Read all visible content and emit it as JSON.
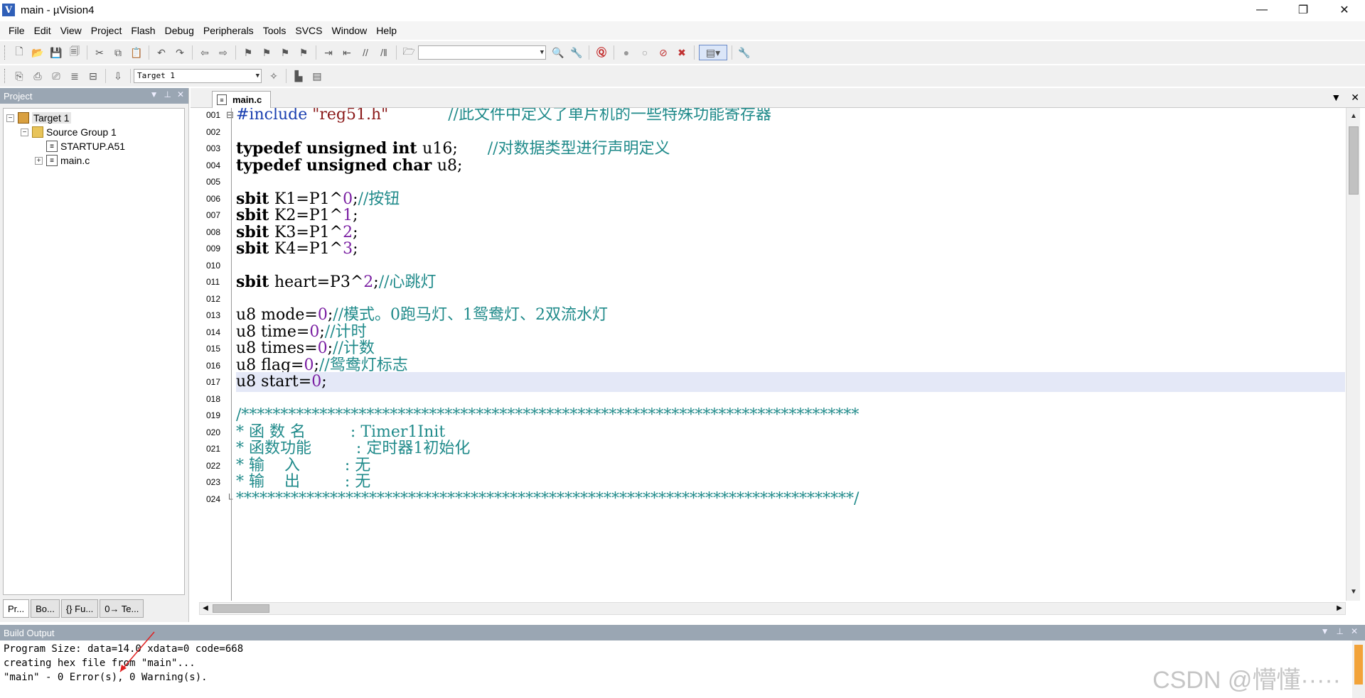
{
  "window": {
    "title": "main - µVision4",
    "controls": [
      "—",
      "❐",
      "✕"
    ]
  },
  "menu": [
    "File",
    "Edit",
    "View",
    "Project",
    "Flash",
    "Debug",
    "Peripherals",
    "Tools",
    "SVCS",
    "Window",
    "Help"
  ],
  "toolbar2": {
    "target_combo": "Target 1"
  },
  "project_pane": {
    "title": "Project",
    "tree": {
      "target": "Target 1",
      "group": "Source Group 1",
      "files": [
        "STARTUP.A51",
        "main.c"
      ]
    },
    "tabs": [
      "Pr...",
      "Bo...",
      "{} Fu...",
      "0→ Te..."
    ]
  },
  "editor": {
    "tab_label": "main.c",
    "lines": [
      {
        "n": "001",
        "fold": "⊟",
        "segments": [
          {
            "t": "#include ",
            "c": "pp"
          },
          {
            "t": "\"reg51.h\"",
            "c": "str"
          },
          {
            "t": "            //此文件中定义了单片机的一些特殊功能寄存器",
            "c": "cmt"
          }
        ]
      },
      {
        "n": "002",
        "segments": []
      },
      {
        "n": "003",
        "segments": [
          {
            "t": "typedef unsigned int ",
            "c": "kw"
          },
          {
            "t": "u16;",
            "c": "op"
          },
          {
            "t": "      //对数据类型进行声明定义",
            "c": "cmt"
          }
        ]
      },
      {
        "n": "004",
        "segments": [
          {
            "t": "typedef unsigned char ",
            "c": "kw"
          },
          {
            "t": "u8;",
            "c": "op"
          }
        ]
      },
      {
        "n": "005",
        "segments": []
      },
      {
        "n": "006",
        "segments": [
          {
            "t": "sbit ",
            "c": "kw"
          },
          {
            "t": "K1=P1^",
            "c": "op"
          },
          {
            "t": "0",
            "c": "num"
          },
          {
            "t": ";",
            "c": "op"
          },
          {
            "t": "//按钮",
            "c": "cmt"
          }
        ]
      },
      {
        "n": "007",
        "segments": [
          {
            "t": "sbit ",
            "c": "kw"
          },
          {
            "t": "K2=P1^",
            "c": "op"
          },
          {
            "t": "1",
            "c": "num"
          },
          {
            "t": ";",
            "c": "op"
          }
        ]
      },
      {
        "n": "008",
        "segments": [
          {
            "t": "sbit ",
            "c": "kw"
          },
          {
            "t": "K3=P1^",
            "c": "op"
          },
          {
            "t": "2",
            "c": "num"
          },
          {
            "t": ";",
            "c": "op"
          }
        ]
      },
      {
        "n": "009",
        "segments": [
          {
            "t": "sbit ",
            "c": "kw"
          },
          {
            "t": "K4=P1^",
            "c": "op"
          },
          {
            "t": "3",
            "c": "num"
          },
          {
            "t": ";",
            "c": "op"
          }
        ]
      },
      {
        "n": "010",
        "segments": []
      },
      {
        "n": "011",
        "segments": [
          {
            "t": "sbit ",
            "c": "kw"
          },
          {
            "t": "heart=P3^",
            "c": "op"
          },
          {
            "t": "2",
            "c": "num"
          },
          {
            "t": ";",
            "c": "op"
          },
          {
            "t": "//心跳灯",
            "c": "cmt"
          }
        ]
      },
      {
        "n": "012",
        "segments": []
      },
      {
        "n": "013",
        "segments": [
          {
            "t": "u8 mode=",
            "c": "op"
          },
          {
            "t": "0",
            "c": "num"
          },
          {
            "t": ";",
            "c": "op"
          },
          {
            "t": "//模式。0跑马灯、1鸳鸯灯、2双流水灯",
            "c": "cmt"
          }
        ]
      },
      {
        "n": "014",
        "segments": [
          {
            "t": "u8 time=",
            "c": "op"
          },
          {
            "t": "0",
            "c": "num"
          },
          {
            "t": ";",
            "c": "op"
          },
          {
            "t": "//计时",
            "c": "cmt"
          }
        ]
      },
      {
        "n": "015",
        "segments": [
          {
            "t": "u8 times=",
            "c": "op"
          },
          {
            "t": "0",
            "c": "num"
          },
          {
            "t": ";",
            "c": "op"
          },
          {
            "t": "//计数",
            "c": "cmt"
          }
        ]
      },
      {
        "n": "016",
        "segments": [
          {
            "t": "u8 flag=",
            "c": "op"
          },
          {
            "t": "0",
            "c": "num"
          },
          {
            "t": ";",
            "c": "op"
          },
          {
            "t": "//鸳鸯灯标志",
            "c": "cmt"
          }
        ]
      },
      {
        "n": "017",
        "current": true,
        "segments": [
          {
            "t": "u8 start=",
            "c": "op"
          },
          {
            "t": "0",
            "c": "num"
          },
          {
            "t": ";",
            "c": "op"
          }
        ]
      },
      {
        "n": "018",
        "segments": []
      },
      {
        "n": "019",
        "segments": [
          {
            "t": "/*******************************************************************************",
            "c": "cmt"
          }
        ]
      },
      {
        "n": "020",
        "segments": [
          {
            "t": "* 函 数 名         : Timer1Init",
            "c": "cmt"
          }
        ]
      },
      {
        "n": "021",
        "segments": [
          {
            "t": "* 函数功能         : 定时器1初始化",
            "c": "cmt"
          }
        ]
      },
      {
        "n": "022",
        "segments": [
          {
            "t": "* 输    入         : 无",
            "c": "cmt"
          }
        ]
      },
      {
        "n": "023",
        "segments": [
          {
            "t": "* 输    出         : 无",
            "c": "cmt"
          }
        ]
      },
      {
        "n": "024",
        "fold": "└",
        "segments": [
          {
            "t": "*******************************************************************************/",
            "c": "cmt"
          }
        ]
      }
    ]
  },
  "build_output": {
    "title": "Build Output",
    "lines": [
      "Program Size: data=14.0 xdata=0 code=668",
      "creating hex file from \"main\"...",
      "\"main\" - 0 Error(s), 0 Warning(s)."
    ]
  },
  "watermark": "CSDN @懵懂·····",
  "colors": {
    "pane_header": "#9aa6b3",
    "keyword": "#000000",
    "string": "#8b1a1a",
    "number": "#7a1fa2",
    "comment": "#1f8a8a",
    "preprocessor": "#1a3fb0",
    "current_line": "#e4e8f7",
    "annotation_arrow": "#e02020"
  }
}
